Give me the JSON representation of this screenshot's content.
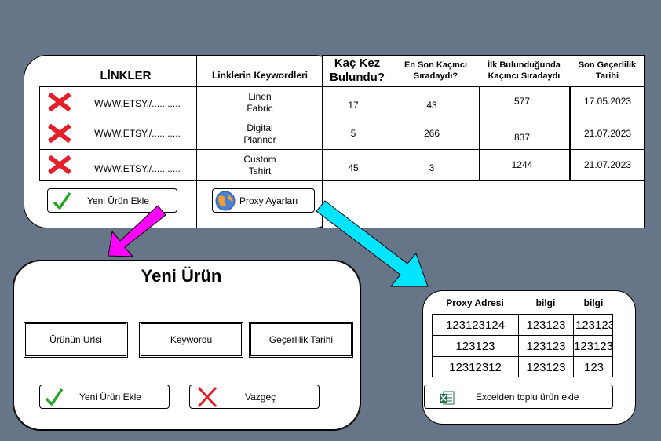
{
  "main_panel": {
    "links_header": "LİNKLER",
    "keywords_header": "Linklerin Keywordleri",
    "rows": [
      {
        "link": "WWW.ETSY./...........",
        "keyword_line1": "Linen",
        "keyword_line2": "Fabric"
      },
      {
        "link": "WWW.ETSY./...........",
        "keyword_line1": "Digital",
        "keyword_line2": "Planner"
      },
      {
        "link": "WWW.ETSY./...........",
        "keyword_line1": "Custom",
        "keyword_line2": "Tshirt"
      }
    ],
    "add_button_label": "Yeni Ürün Ekle",
    "proxy_button_label": "Proxy Ayarları"
  },
  "stats_table": {
    "headers": {
      "found_count": [
        "Kaç Kez",
        "Bulundu?"
      ],
      "last_rank": [
        "En Son Kaçıncı",
        "Sıradaydı?"
      ],
      "first_rank": [
        "İlk Bulunduğunda",
        "Kaçıncı Sıradaydı"
      ],
      "expiry": [
        "Son Geçerlilik",
        "Tarihi"
      ]
    },
    "rows": [
      {
        "found_count": "17",
        "last_rank": "43",
        "first_rank": "577",
        "expiry": "17.05.2023"
      },
      {
        "found_count": "5",
        "last_rank": "266",
        "first_rank": "837",
        "expiry": "21.07.2023"
      },
      {
        "found_count": "45",
        "last_rank": "3",
        "first_rank": "1244",
        "expiry": "21.07.2023"
      }
    ]
  },
  "new_product_dialog": {
    "title": "Yeni Ürün",
    "fields": {
      "url": "Ürünün Urlsi",
      "keyword": "Keywordu",
      "expiry": "Geçerlilik Tarihi"
    },
    "add_button_label": "Yeni Ürün Ekle",
    "cancel_button_label": "Vazgeç"
  },
  "proxy_dialog": {
    "headers": [
      "Proxy Adresi",
      "bilgi",
      "bilgi"
    ],
    "rows": [
      [
        "123123124",
        "123123",
        "123123"
      ],
      [
        "123123",
        "123123",
        "123123"
      ],
      [
        "12312312",
        "123123",
        "123"
      ]
    ],
    "excel_button_label": "Excelden toplu ürün ekle"
  },
  "colors": {
    "background": "#667588",
    "delete_icon": "#e6202a",
    "check_icon": "#2aa52a",
    "arrow_magenta": "#ff00ff",
    "arrow_cyan": "#00e5ff",
    "excel_green": "#1e7145"
  }
}
